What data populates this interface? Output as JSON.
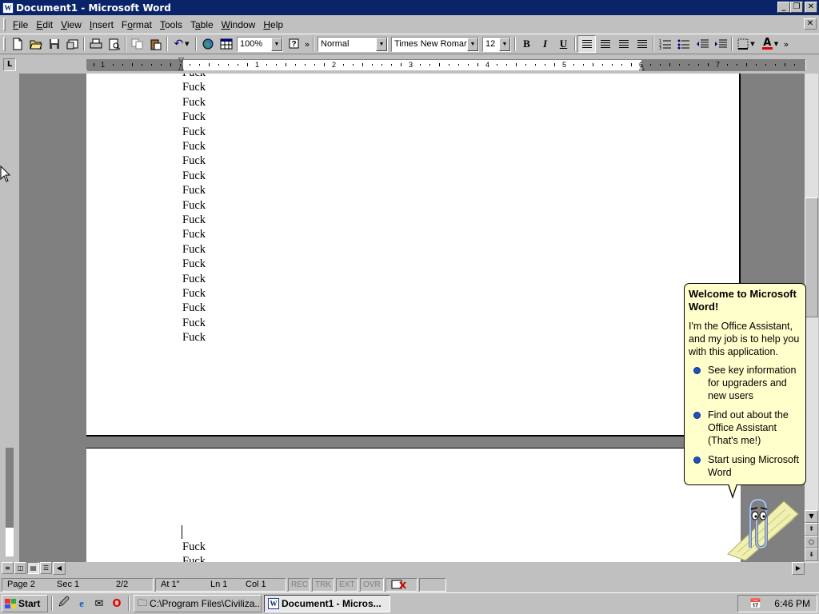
{
  "window": {
    "title": "Document1 - Microsoft Word",
    "app_icon": "W",
    "minimize_glyph": "_",
    "maximize_glyph": "❐",
    "close_glyph": "✕"
  },
  "menu": {
    "items": [
      {
        "label": "File",
        "underline": "F",
        "rest": "ile"
      },
      {
        "label": "Edit",
        "underline": "E",
        "rest": "dit"
      },
      {
        "label": "View",
        "underline": "V",
        "rest": "iew"
      },
      {
        "label": "Insert",
        "underline": "I",
        "rest": "nsert"
      },
      {
        "label": "Format",
        "pre": "F",
        "underline": "o",
        "rest": "rmat"
      },
      {
        "label": "Tools",
        "underline": "T",
        "rest": "ools"
      },
      {
        "label": "Table",
        "pre": "T",
        "underline": "a",
        "rest": "ble"
      },
      {
        "label": "Window",
        "underline": "W",
        "rest": "indow"
      },
      {
        "label": "Help",
        "underline": "H",
        "rest": "elp"
      }
    ],
    "doc_close_glyph": "✕"
  },
  "toolbar": {
    "zoom": "100%",
    "style": "Normal",
    "font": "Times New Roman",
    "size": "12",
    "bold": "B",
    "italic": "I",
    "underline": "U",
    "more": "»",
    "font_color_letter": "A"
  },
  "ruler": {
    "numbers": [
      "1",
      "1",
      "2",
      "3",
      "4",
      "5",
      "6",
      "7"
    ],
    "tab_selector": "L"
  },
  "document": {
    "page1_lines": [
      "Fuck",
      "Fuck",
      "Fuck",
      "Fuck",
      "Fuck",
      "Fuck",
      "Fuck",
      "Fuck",
      "Fuck",
      "Fuck",
      "Fuck",
      "Fuck",
      "Fuck",
      "Fuck",
      "Fuck",
      "Fuck",
      "Fuck",
      "Fuck",
      "Fuck"
    ],
    "page2_lines": [
      "Fuck",
      "Fuck"
    ]
  },
  "statusbar": {
    "page": "Page 2",
    "sec": "Sec 1",
    "pages": "2/2",
    "at": "At 1\"",
    "ln": "Ln 1",
    "col": "Col 1",
    "rec": "REC",
    "trk": "TRK",
    "ext": "EXT",
    "ovr": "OVR"
  },
  "assistant": {
    "title": "Welcome to Microsoft Word!",
    "intro": "I'm the Office Assistant, and my job is to help you with this application.",
    "options": [
      "See key information for upgraders and new users",
      "Find out about the Office Assistant (That's me!)",
      "Start using Microsoft Word"
    ]
  },
  "taskbar": {
    "start": "Start",
    "tasks": [
      {
        "label": "C:\\Program Files\\Civiliza...",
        "active": false
      },
      {
        "label": "Document1 - Micros...",
        "active": true
      }
    ],
    "clock": "6:46 PM"
  },
  "colors": {
    "titlebar": "#0a246a",
    "workspace": "#808080",
    "balloon": "#ffffcc",
    "bullet": "#2050c0"
  }
}
